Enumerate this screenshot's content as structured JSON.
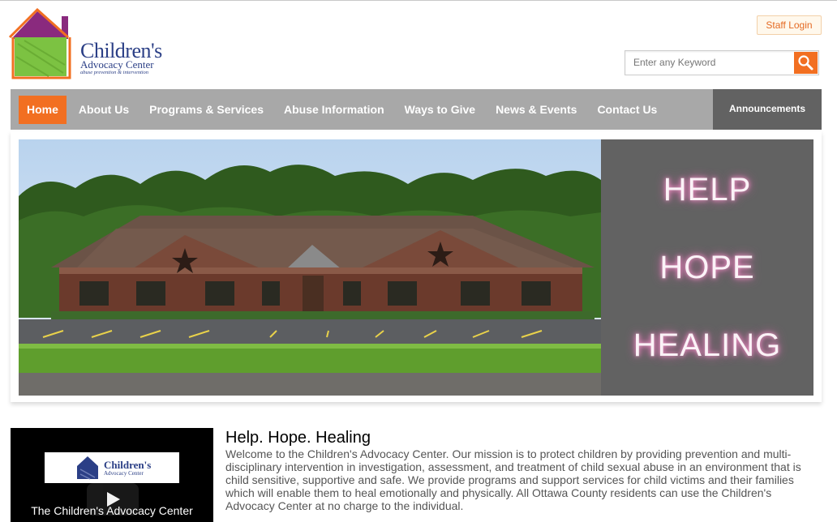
{
  "logo": {
    "title": "Children's",
    "subtitle": "Advocacy Center",
    "tagline": "abuse prevention & intervention"
  },
  "header": {
    "staff_login": "Staff Login",
    "search_placeholder": "Enter any Keyword",
    "search_icon": "search-icon"
  },
  "nav": {
    "items": [
      {
        "label": "Home",
        "active": true
      },
      {
        "label": "About Us"
      },
      {
        "label": "Programs & Services"
      },
      {
        "label": "Abuse Information"
      },
      {
        "label": "Ways to Give"
      },
      {
        "label": "News & Events"
      },
      {
        "label": "Contact Us"
      }
    ],
    "announcements": "Announcements"
  },
  "banner": {
    "words": [
      "HELP",
      "HOPE",
      "HEALING"
    ]
  },
  "video": {
    "logo_title": "Children's",
    "logo_subtitle": "Advocacy Center",
    "caption": "The Children's Advocacy Center"
  },
  "content": {
    "title": "Help. Hope. Healing",
    "body": "Welcome to the Children's Advocacy Center. Our mission is to protect children by providing prevention and multi-disciplinary intervention in investigation, assessment, and treatment of child sexual abuse in an environment that is child sensitive, supportive and safe. We provide programs and support services for child victims and their families which will enable them to heal emotionally and physically. All Ottawa County residents can use the Children's Advocacy Center at no charge to the individual."
  },
  "colors": {
    "accent": "#f26f21",
    "nav_bg": "#a8a8a8",
    "panel_bg": "#626262",
    "brand_blue": "#2b3f86"
  }
}
